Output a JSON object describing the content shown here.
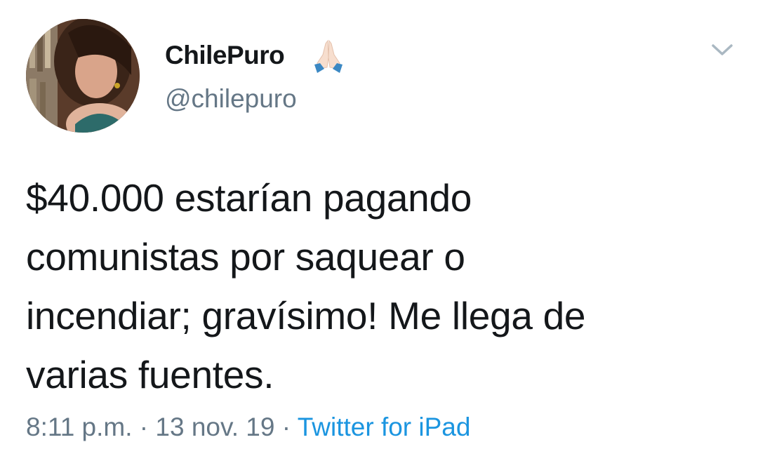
{
  "user": {
    "display_name": "ChilePuro",
    "name_emoji": "folded-hands-icon",
    "handle": "@chilepuro"
  },
  "tweet": {
    "lines": [
      "$40.000 estarían pagando",
      "comunistas por saquear o",
      "incendiar; gravísimo! Me llega de",
      "varias fuentes."
    ],
    "time": "8:11 p.m.",
    "separator": "·",
    "date": "13 nov. 19",
    "source": "Twitter for iPad"
  },
  "colors": {
    "text": "#14171a",
    "secondary": "#657786",
    "link": "#1b95e0"
  }
}
